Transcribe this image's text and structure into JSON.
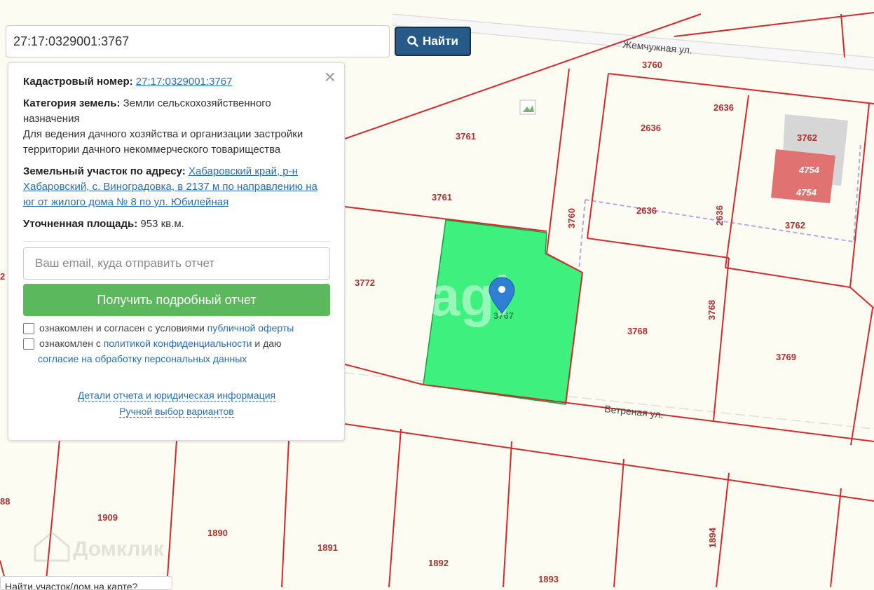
{
  "search": {
    "value": "27:17:0329001:3767",
    "button_label": "Найти",
    "button_icon": "search-icon"
  },
  "info_panel": {
    "cadastral_label": "Кадастровый номер:",
    "cadastral_value": "27:17:0329001:3767",
    "category_label": "Категория земель:",
    "category_value": "Земли сельскохозяйственного назначения",
    "usage": "Для ведения дачного хозяйства и организации застройки территории дачного некоммерческого товарищества",
    "address_label": "Земельный участок по адресу:",
    "address_value": "Хабаровский край, р-н Хабаровский, с. Виноградовка, в 2137 м по направлению на юг от жилого дома № 8 по ул. Юбилейная",
    "area_label": "Уточненная площадь:",
    "area_value": "953 кв.м.",
    "email_placeholder": "Ваш email, куда отправить отчет",
    "report_button": "Получить подробный отчет",
    "offer_text": "ознакомлен и согласен с условиями",
    "offer_link": "публичной оферты",
    "privacy_prefix": "ознакомлен с",
    "privacy_link": "политикой конфиденциальности",
    "privacy_suffix": "и даю",
    "consent_link": "согласие на обработку персональных данных",
    "details_link": "Детали отчета и юридическая информация",
    "manual_link": "Ручной выбор вариантов",
    "close_icon": "close-icon"
  },
  "map": {
    "streets": [
      "Жемчужная ул.",
      "Ветреная ул."
    ],
    "plot_labels": [
      "3760",
      "3761",
      "3761",
      "2636",
      "2636",
      "2636",
      "2636",
      "3762",
      "4754",
      "4754",
      "3762",
      "3760",
      "3772",
      "3767",
      "3768",
      "3768",
      "3769",
      "1909",
      "1890",
      "1891",
      "1892",
      "1893",
      "1894",
      "88",
      "2"
    ],
    "watermark": "agi",
    "brand_logo": "Домклик",
    "selected_color": "#3ef07e",
    "parcel_color": "#d42a2a",
    "marker_color": "#2f7fd4"
  },
  "bottom_hint": "Найти участок/дом на карте?"
}
